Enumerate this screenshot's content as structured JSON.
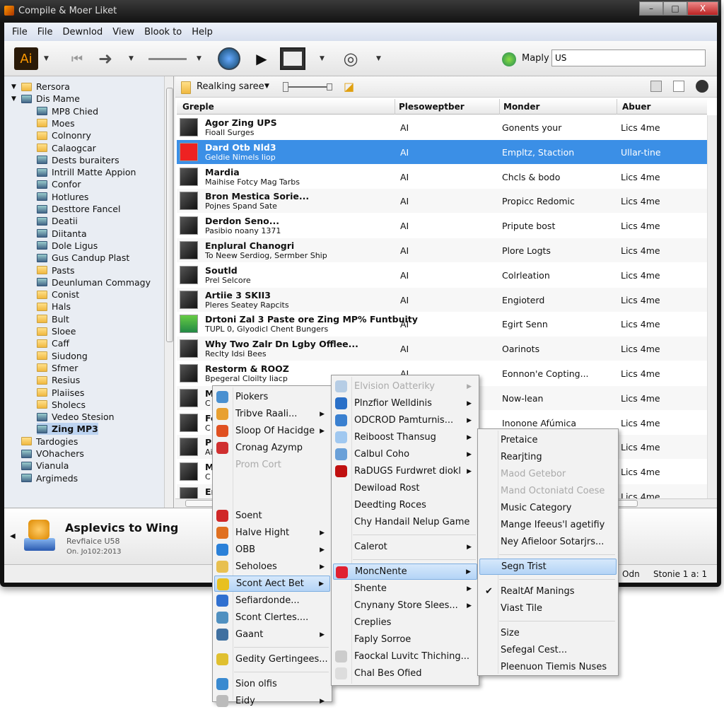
{
  "window": {
    "title": "Compile & Moer Liket",
    "min": "–",
    "max": "□",
    "close": "X"
  },
  "menubar": [
    "File",
    "File",
    "Dewnlod",
    "View",
    "Blook to",
    "Help"
  ],
  "toolbar": {
    "search_label": "Maply",
    "search_value": "US",
    "app_icon": "Ai"
  },
  "tree": [
    {
      "label": "Rersora",
      "level": 0,
      "expanded": true,
      "icon": "folder"
    },
    {
      "label": "Dis Mame",
      "level": 0,
      "expanded": true,
      "icon": "computer"
    },
    {
      "label": "MP8 Chied",
      "level": 2,
      "icon": "camera"
    },
    {
      "label": "Moes",
      "level": 2,
      "icon": "folder"
    },
    {
      "label": "Colnonry",
      "level": 2,
      "icon": "folder"
    },
    {
      "label": "Calaogcar",
      "level": 2,
      "icon": "folder"
    },
    {
      "label": "Dests buraiters",
      "level": 2,
      "icon": "image"
    },
    {
      "label": "Intrill Matte Appion",
      "level": 2,
      "icon": "disc"
    },
    {
      "label": "Confor",
      "level": 2,
      "icon": "clock"
    },
    {
      "label": "Hotlures",
      "level": 2,
      "icon": "globe"
    },
    {
      "label": "Desttore Fancel",
      "level": 2,
      "icon": "leaf"
    },
    {
      "label": "Deatii",
      "level": 2,
      "icon": "globe"
    },
    {
      "label": "Diitanta",
      "level": 2,
      "icon": "leaf"
    },
    {
      "label": "Dole Ligus",
      "level": 2,
      "icon": "leaf"
    },
    {
      "label": "Gus Candup Plast",
      "level": 2,
      "icon": "app"
    },
    {
      "label": "Pasts",
      "level": 2,
      "icon": "folder"
    },
    {
      "label": "Deunluman Commagy",
      "level": 2,
      "icon": "app"
    },
    {
      "label": "Conist",
      "level": 2,
      "icon": "folder"
    },
    {
      "label": "Hals",
      "level": 2,
      "icon": "folder"
    },
    {
      "label": "Bult",
      "level": 2,
      "icon": "folder"
    },
    {
      "label": "Sloee",
      "level": 2,
      "icon": "folder"
    },
    {
      "label": "Caff",
      "level": 2,
      "icon": "folder"
    },
    {
      "label": "Siudong",
      "level": 2,
      "icon": "folder"
    },
    {
      "label": "Sfmer",
      "level": 2,
      "icon": "folder"
    },
    {
      "label": "Resius",
      "level": 2,
      "icon": "folder"
    },
    {
      "label": "Plaiises",
      "level": 2,
      "icon": "folder"
    },
    {
      "label": "Sholecs",
      "level": 2,
      "icon": "folder"
    },
    {
      "label": "Vedeo Stesion",
      "level": 2,
      "icon": "chart"
    },
    {
      "label": "Zing MP3",
      "level": 2,
      "icon": "app",
      "selected": true
    },
    {
      "label": "Tardogies",
      "level": 1,
      "icon": "folder"
    },
    {
      "label": "VOhachers",
      "level": 1,
      "icon": "triangle"
    },
    {
      "label": "Vianula",
      "level": 1,
      "icon": "app"
    },
    {
      "label": "Argimeds",
      "level": 1,
      "icon": "image"
    }
  ],
  "subbar": {
    "label": "Realking saree"
  },
  "table": {
    "columns": [
      "Greple",
      "Plesoweptber",
      "Monder",
      "Abuer"
    ],
    "rows": [
      {
        "title": "Agor Zing UPS",
        "sub": "Fioall Surges",
        "c2": "AI",
        "c3": "Gonents your",
        "c4": "Lics 4me"
      },
      {
        "title": "Dard Otb Nld3",
        "sub": "Geldie Nimels Iiop",
        "c2": "AI",
        "c3": "Empltz, Staction",
        "c4": "Ullar-tine",
        "selected": true
      },
      {
        "title": "Mardia",
        "sub": "Maihise Fotcy Mag Tarbs",
        "c2": "AI",
        "c3": "Chcls & bodo",
        "c4": "Lics 4me"
      },
      {
        "title": "Bron Mestica Sorie...",
        "sub": "Pojnes Spand Sate",
        "c2": "AI",
        "c3": "Propicc Redomic",
        "c4": "Lics 4me"
      },
      {
        "title": "Derdon Seno...",
        "sub": "Pasibio noany 1371",
        "c2": "AI",
        "c3": "Pripute bost",
        "c4": "Lics 4me"
      },
      {
        "title": "Enplural Chanogri",
        "sub": "To Neew Serdiog, Sermber Ship",
        "c2": "AI",
        "c3": "Plore Logts",
        "c4": "Lics 4me"
      },
      {
        "title": "Soutld",
        "sub": "Prel Selcore",
        "c2": "AI",
        "c3": "Colrleation",
        "c4": "Lics 4me"
      },
      {
        "title": "Artiie 3 SKII3",
        "sub": "Pleres Seatey Rapcits",
        "c2": "AI",
        "c3": "Engioterd",
        "c4": "Lics 4me"
      },
      {
        "title": "Drtoni Zal 3 Paste ore Zing MP% Funtbuity",
        "sub": "TUPL 0, Glyodicl Chent Bungers",
        "c2": "AI",
        "c3": "Egirt Senn",
        "c4": "Lics 4me"
      },
      {
        "title": "Why Two Zalr Dn Lgby Offlee...",
        "sub": "Reclty Idsi Bees",
        "c2": "AI",
        "c3": "Oarinots",
        "c4": "Lics 4me"
      },
      {
        "title": "Restorm & ROOZ",
        "sub": "Bpegeral Cloilty Iiacp",
        "c2": "AI",
        "c3": "Eonnon'e Copting...",
        "c4": "Lics 4me"
      },
      {
        "title": "M",
        "sub": "C",
        "c2": "",
        "c3": "Now-lean",
        "c4": "Lics 4me"
      },
      {
        "title": "Fe",
        "sub": "C",
        "c2": "",
        "c3": "Inonone Afúmica",
        "c4": "Lics 4me"
      },
      {
        "title": "P",
        "sub": "Ai",
        "c2": "",
        "c3": "",
        "c4": "Lics 4me"
      },
      {
        "title": "M",
        "sub": "C",
        "c2": "",
        "c3": "",
        "c4": "Lics 4me"
      },
      {
        "title": "En",
        "sub": "",
        "c2": "",
        "c3": "",
        "c4": "Lics 4me"
      }
    ]
  },
  "detail": {
    "title": "Asplevics to Wing",
    "line1": "Revfiaice U58",
    "line2": "On. Jo102:2013"
  },
  "status": {
    "left": "Odn",
    "right": "Stonie 1 a:  1"
  },
  "menus": [
    {
      "items": [
        {
          "label": "Piokers",
          "icon": "#4a90d0"
        },
        {
          "label": "Tribve Raali...",
          "icon": "#e8a030",
          "sub": true
        },
        {
          "label": "Sloop Of Hacidge",
          "icon": "#e05020",
          "sub": true
        },
        {
          "label": "Cronag Azymp",
          "icon": "#d03030"
        },
        {
          "label": "Prom Cort",
          "disabled": true
        },
        {
          "label": "",
          "disabled": true
        },
        {
          "label": "",
          "disabled": true
        },
        {
          "label": "Soent",
          "icon": "#d02828"
        },
        {
          "label": "Halve Hight",
          "icon": "#e07020",
          "sub": true
        },
        {
          "label": "OBB",
          "icon": "#2a80d8",
          "sub": true
        },
        {
          "label": "Seholoes",
          "icon": "#e8c050",
          "sub": true
        },
        {
          "label": "Scont Aect Bet",
          "icon": "#e8c020",
          "sub": true,
          "highlight": true
        },
        {
          "label": "Sefiardonde...",
          "icon": "#3070d0"
        },
        {
          "label": "Scont Clertes....",
          "icon": "#5090c0"
        },
        {
          "label": "Gaant",
          "icon": "#4070a0",
          "sub": true
        },
        {
          "sep": true
        },
        {
          "label": "Gedity Gertingees...",
          "icon": "#e0c030"
        },
        {
          "sep": true
        },
        {
          "label": "Sion olfis",
          "icon": "#3a8ad0"
        },
        {
          "label": "Eidy",
          "icon": "#bbbbbb",
          "sub": true
        }
      ]
    },
    {
      "items": [
        {
          "label": "Elvision Oatteriky",
          "icon": "#7aa8d8",
          "sub": true,
          "disabled": true
        },
        {
          "label": "Plnzfior Welldinis",
          "icon": "#2a70c8",
          "sub": true
        },
        {
          "label": "ODCROD Pamturnis...",
          "icon": "#3a80d0",
          "sub": true
        },
        {
          "label": "Reiboost Thansug",
          "icon": "#a0c8f0",
          "sub": true
        },
        {
          "label": "Calbul Coho",
          "icon": "#6aa0d8",
          "sub": true
        },
        {
          "label": "RaDUGS Furdwret diokl",
          "icon": "#c01010",
          "sub": true
        },
        {
          "label": "Dewiload Rost"
        },
        {
          "label": "Deedting Roces"
        },
        {
          "label": "Chy Handail Nelup Game"
        },
        {
          "sep": true
        },
        {
          "label": "Calerot",
          "sub": true
        },
        {
          "sep": true
        },
        {
          "label": "MoncNente",
          "icon": "#e02030",
          "sub": true,
          "highlight": true
        },
        {
          "label": "Shente",
          "sub": true
        },
        {
          "label": "Cnynany Store Slees...",
          "sub": true
        },
        {
          "label": "Creplies"
        },
        {
          "label": "Faply Sorroe"
        },
        {
          "label": "Faockal Luvitc Thiching...",
          "icon": "#cccccc"
        },
        {
          "label": "Chal Bes Ofied",
          "icon": "#dddddd"
        }
      ]
    },
    {
      "items": [
        {
          "label": "Pretaice"
        },
        {
          "label": "Rearjting"
        },
        {
          "label": "Maod Getebor",
          "disabled": true
        },
        {
          "label": "Mand Octoniatd Coese",
          "disabled": true
        },
        {
          "label": "Music Category"
        },
        {
          "label": "Mange Ifeeus'l agetifiy"
        },
        {
          "label": "Ney Afieloor Sotarjrs..."
        },
        {
          "sep": true
        },
        {
          "label": "Segn Trist",
          "highlight": true
        },
        {
          "sep": true
        },
        {
          "label": "RealtAf Manings",
          "checked": true
        },
        {
          "label": "Viast Tile"
        },
        {
          "sep": true
        },
        {
          "label": "Size"
        },
        {
          "label": "Sefegal Cest..."
        },
        {
          "label": "Pleenuon Tiemis Nuses"
        }
      ]
    }
  ],
  "colors": {
    "selection": "#3b8fe6",
    "menu_highlight": "#b4d4f6"
  }
}
